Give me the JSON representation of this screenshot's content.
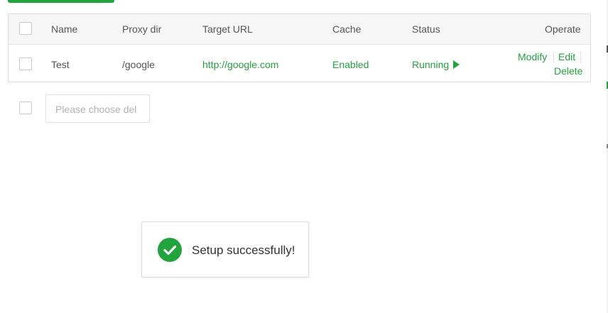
{
  "table": {
    "headers": {
      "name": "Name",
      "proxy_dir": "Proxy dir",
      "target_url": "Target URL",
      "cache": "Cache",
      "status": "Status",
      "operate": "Operate"
    },
    "rows": [
      {
        "name": "Test",
        "proxy_dir": "/google",
        "target_url": "http://google.com",
        "cache": "Enabled",
        "status": "Running",
        "actions": {
          "modify": "Modify",
          "edit": "Edit",
          "delete": "Delete"
        }
      }
    ]
  },
  "bulk": {
    "placeholder": "Please choose del"
  },
  "toast": {
    "message": "Setup successfully!"
  },
  "colors": {
    "accent": "#20a53a",
    "border": "#dddddd",
    "header_bg": "#f6f6f6"
  },
  "icons": {
    "toast": "check-circle-icon",
    "status": "play-icon"
  }
}
